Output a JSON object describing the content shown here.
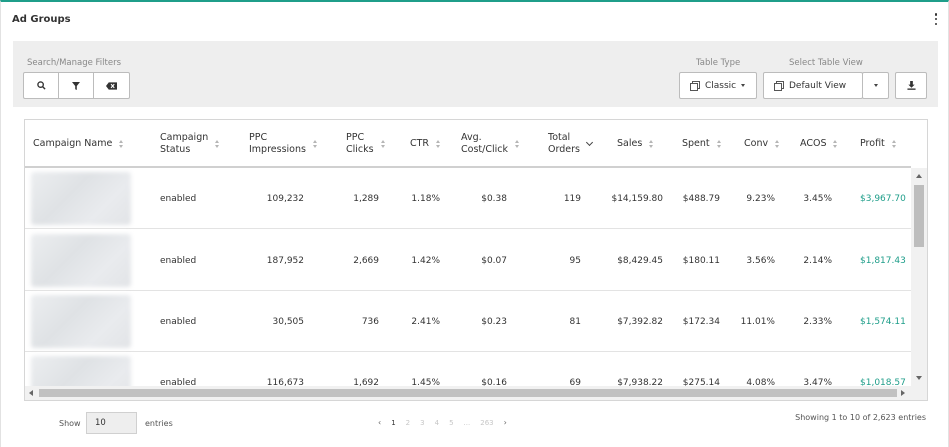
{
  "card": {
    "title": "Ad Groups"
  },
  "filters": {
    "search_manage_label": "Search/Manage Filters",
    "table_type_label": "Table Type",
    "table_type_value": "Classic",
    "select_view_label": "Select Table View",
    "select_view_value": "Default View"
  },
  "columns": [
    {
      "l1": "Campaign Name",
      "l2": ""
    },
    {
      "l1": "Campaign",
      "l2": "Status"
    },
    {
      "l1": "PPC",
      "l2": "Impressions"
    },
    {
      "l1": "PPC",
      "l2": "Clicks"
    },
    {
      "l1": "CTR",
      "l2": ""
    },
    {
      "l1": "Avg.",
      "l2": "Cost/Click"
    },
    {
      "l1": "Total",
      "l2": "Orders"
    },
    {
      "l1": "Sales",
      "l2": ""
    },
    {
      "l1": "Spent",
      "l2": ""
    },
    {
      "l1": "Conv",
      "l2": ""
    },
    {
      "l1": "ACOS",
      "l2": ""
    },
    {
      "l1": "Profit",
      "l2": ""
    }
  ],
  "rows": [
    {
      "status": "enabled",
      "impressions": "109,232",
      "clicks": "1,289",
      "ctr": "1.18%",
      "cpc": "$0.38",
      "orders": "119",
      "sales": "$14,159.80",
      "spent": "$488.79",
      "conv": "9.23%",
      "acos": "3.45%",
      "profit": "$3,967.70"
    },
    {
      "status": "enabled",
      "impressions": "187,952",
      "clicks": "2,669",
      "ctr": "1.42%",
      "cpc": "$0.07",
      "orders": "95",
      "sales": "$8,429.45",
      "spent": "$180.11",
      "conv": "3.56%",
      "acos": "2.14%",
      "profit": "$1,817.43"
    },
    {
      "status": "enabled",
      "impressions": "30,505",
      "clicks": "736",
      "ctr": "2.41%",
      "cpc": "$0.23",
      "orders": "81",
      "sales": "$7,392.82",
      "spent": "$172.34",
      "conv": "11.01%",
      "acos": "2.33%",
      "profit": "$1,574.11"
    },
    {
      "status": "enabled",
      "impressions": "116,673",
      "clicks": "1,692",
      "ctr": "1.45%",
      "cpc": "$0.16",
      "orders": "69",
      "sales": "$7,938.22",
      "spent": "$275.14",
      "conv": "4.08%",
      "acos": "3.47%",
      "profit": "$1,018.57"
    }
  ],
  "footer": {
    "show_label": "Show",
    "page_size": "10",
    "entries_label": "entries",
    "pages": [
      "1",
      "2",
      "3",
      "4",
      "5",
      "...",
      "263"
    ],
    "next": "›",
    "prev": "‹",
    "showing_text": "Showing 1 to 10 of 2,623 entries"
  }
}
